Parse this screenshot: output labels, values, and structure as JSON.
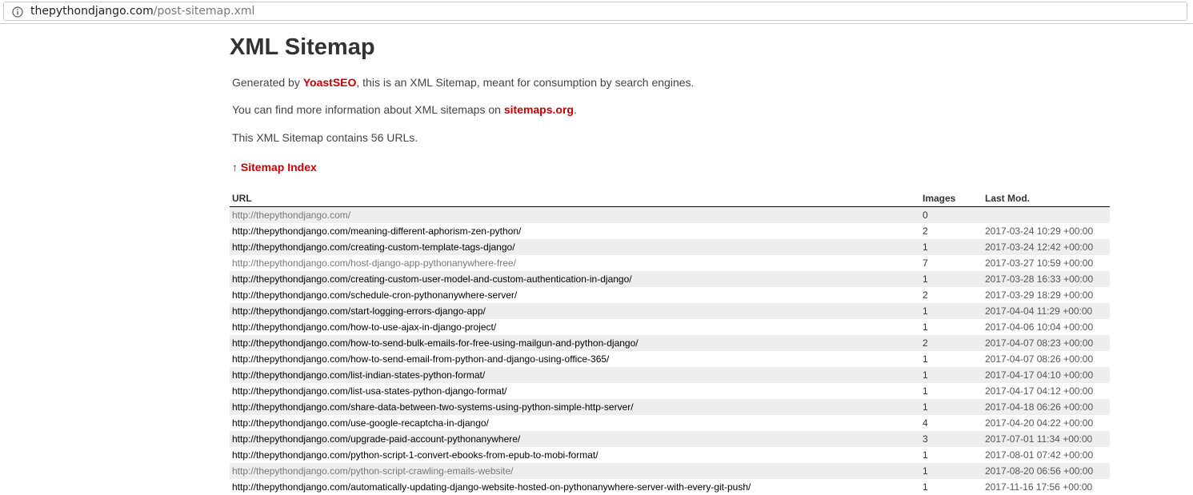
{
  "browser": {
    "url_domain": "thepythondjango.com",
    "url_path": "/post-sitemap.xml"
  },
  "page": {
    "title": "XML Sitemap",
    "intro_prefix": "Generated by ",
    "intro_link": "YoastSEO",
    "intro_suffix": ", this is an XML Sitemap, meant for consumption by search engines.",
    "info_prefix": "You can find more information about XML sitemaps on ",
    "info_link": "sitemaps.org",
    "info_suffix": ".",
    "count_text": "This XML Sitemap contains 56 URLs.",
    "index_link": "↑ Sitemap Index"
  },
  "table": {
    "headers": {
      "url": "URL",
      "images": "Images",
      "last_mod": "Last Mod."
    },
    "rows": [
      {
        "url": "http://thepythondjango.com/",
        "images": "0",
        "last_mod": "",
        "visited": true
      },
      {
        "url": "http://thepythondjango.com/meaning-different-aphorism-zen-python/",
        "images": "2",
        "last_mod": "2017-03-24 10:29 +00:00",
        "visited": false
      },
      {
        "url": "http://thepythondjango.com/creating-custom-template-tags-django/",
        "images": "1",
        "last_mod": "2017-03-24 12:42 +00:00",
        "visited": false
      },
      {
        "url": "http://thepythondjango.com/host-django-app-pythonanywhere-free/",
        "images": "7",
        "last_mod": "2017-03-27 10:59 +00:00",
        "visited": true
      },
      {
        "url": "http://thepythondjango.com/creating-custom-user-model-and-custom-authentication-in-django/",
        "images": "1",
        "last_mod": "2017-03-28 16:33 +00:00",
        "visited": false
      },
      {
        "url": "http://thepythondjango.com/schedule-cron-pythonanywhere-server/",
        "images": "2",
        "last_mod": "2017-03-29 18:29 +00:00",
        "visited": false
      },
      {
        "url": "http://thepythondjango.com/start-logging-errors-django-app/",
        "images": "1",
        "last_mod": "2017-04-04 11:29 +00:00",
        "visited": false
      },
      {
        "url": "http://thepythondjango.com/how-to-use-ajax-in-django-project/",
        "images": "1",
        "last_mod": "2017-04-06 10:04 +00:00",
        "visited": false
      },
      {
        "url": "http://thepythondjango.com/how-to-send-bulk-emails-for-free-using-mailgun-and-python-django/",
        "images": "2",
        "last_mod": "2017-04-07 08:23 +00:00",
        "visited": false
      },
      {
        "url": "http://thepythondjango.com/how-to-send-email-from-python-and-django-using-office-365/",
        "images": "1",
        "last_mod": "2017-04-07 08:26 +00:00",
        "visited": false
      },
      {
        "url": "http://thepythondjango.com/list-indian-states-python-format/",
        "images": "1",
        "last_mod": "2017-04-17 04:10 +00:00",
        "visited": false
      },
      {
        "url": "http://thepythondjango.com/list-usa-states-python-django-format/",
        "images": "1",
        "last_mod": "2017-04-17 04:12 +00:00",
        "visited": false
      },
      {
        "url": "http://thepythondjango.com/share-data-between-two-systems-using-python-simple-http-server/",
        "images": "1",
        "last_mod": "2017-04-18 06:26 +00:00",
        "visited": false
      },
      {
        "url": "http://thepythondjango.com/use-google-recaptcha-in-django/",
        "images": "4",
        "last_mod": "2017-04-20 04:22 +00:00",
        "visited": false
      },
      {
        "url": "http://thepythondjango.com/upgrade-paid-account-pythonanywhere/",
        "images": "3",
        "last_mod": "2017-07-01 11:34 +00:00",
        "visited": false
      },
      {
        "url": "http://thepythondjango.com/python-script-1-convert-ebooks-from-epub-to-mobi-format/",
        "images": "1",
        "last_mod": "2017-08-01 07:42 +00:00",
        "visited": false
      },
      {
        "url": "http://thepythondjango.com/python-script-crawling-emails-website/",
        "images": "1",
        "last_mod": "2017-08-20 06:56 +00:00",
        "visited": true
      },
      {
        "url": "http://thepythondjango.com/automatically-updating-django-website-hosted-on-pythonanywhere-server-with-every-git-push/",
        "images": "1",
        "last_mod": "2017-11-16 17:56 +00:00",
        "visited": false
      }
    ]
  }
}
